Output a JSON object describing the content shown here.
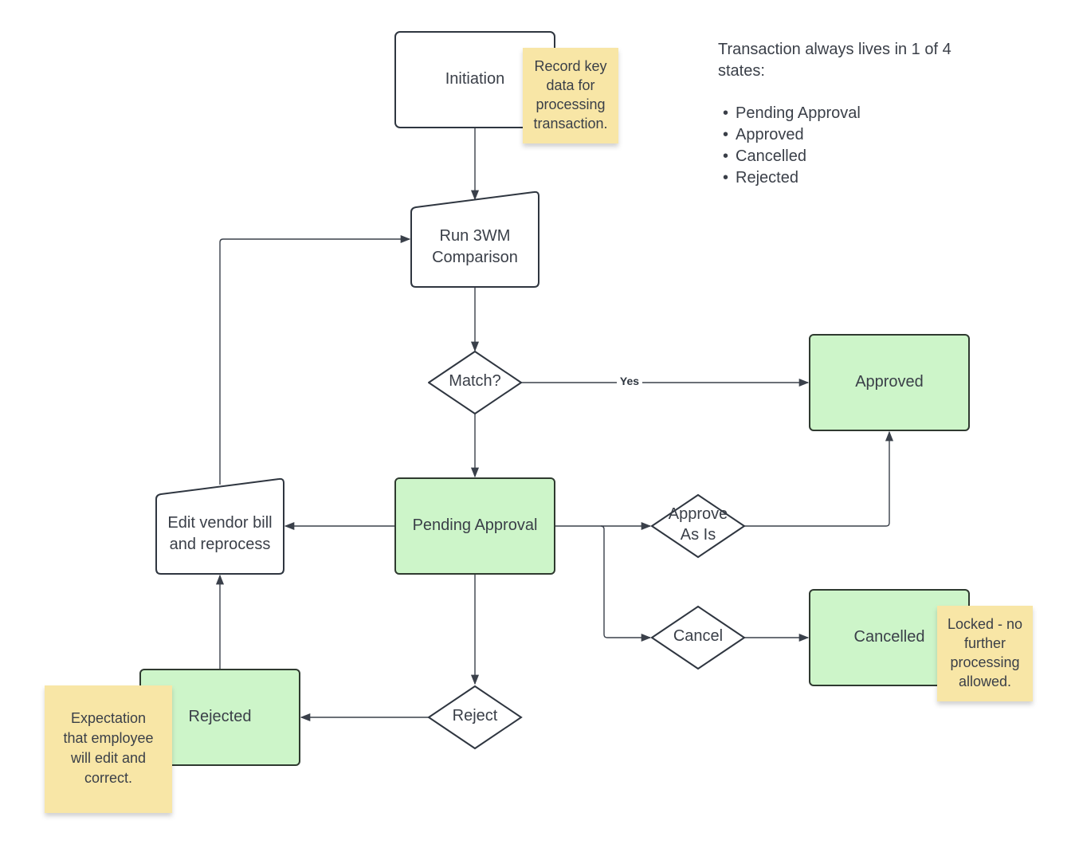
{
  "colors": {
    "state_fill": "#cdf5c9",
    "sticky_fill": "#f8e6a6",
    "stroke": "#2f3640",
    "text": "#3a3f48"
  },
  "nodes": {
    "initiation": "Initiation",
    "run_3wm": [
      "Run 3WM",
      "Comparison"
    ],
    "match": "Match?",
    "approved": "Approved",
    "pending": "Pending Approval",
    "edit_vendor": [
      "Edit vendor bill",
      "and reprocess"
    ],
    "approve_as_is": [
      "Approve",
      "As Is"
    ],
    "cancel": "Cancel",
    "cancelled": "Cancelled",
    "reject": "Reject",
    "rejected": "Rejected"
  },
  "edge_labels": {
    "yes": "Yes"
  },
  "stickies": {
    "initiation": [
      "Record key",
      "data for",
      "processing",
      "transaction."
    ],
    "cancelled": [
      "Locked - no",
      "further",
      "processing",
      "allowed."
    ],
    "rejected": [
      "Expectation",
      "that employee",
      "will edit and",
      "correct."
    ]
  },
  "note": {
    "lines": [
      "Transaction always lives in 1 of 4",
      "states:"
    ],
    "states": [
      "Pending Approval",
      "Approved",
      "Cancelled",
      "Rejected"
    ]
  }
}
